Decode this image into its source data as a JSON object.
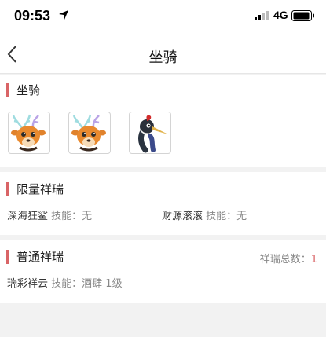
{
  "status_bar": {
    "time": "09:53",
    "network": "4G"
  },
  "header": {
    "title": "坐骑"
  },
  "mounts_section": {
    "title": "坐骑",
    "icons": [
      "deer-mount-icon",
      "deer-mount-icon",
      "crane-mount-icon"
    ]
  },
  "limited_section": {
    "title": "限量祥瑞",
    "items": [
      {
        "name": "深海狂鲨",
        "skill_label": "技能：",
        "skill": "无"
      },
      {
        "name": "财源滚滚",
        "skill_label": "技能：",
        "skill": "无"
      }
    ]
  },
  "common_section": {
    "title": "普通祥瑞",
    "total_label": "祥瑞总数：",
    "total_value": "1",
    "items": [
      {
        "name": "瑞彩祥云",
        "skill_label": "技能：",
        "skill": "酒肆 1级"
      }
    ]
  },
  "colors": {
    "accent": "#d96466",
    "background": "#f2f2f2"
  }
}
